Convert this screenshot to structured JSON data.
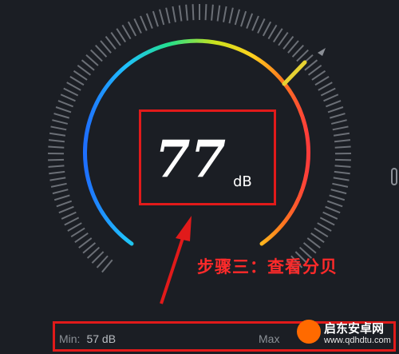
{
  "meter": {
    "value": "77",
    "unit": "dB",
    "arc_colors": [
      "#1e6fff",
      "#1fc0ff",
      "#24e08a",
      "#c9e21e",
      "#ffd11e",
      "#ff7a1e",
      "#ff3b3b"
    ],
    "needle_color": "#e6d233",
    "tick_color": "#6b6f76"
  },
  "annotation": {
    "step_text": "步骤三：查看分贝",
    "highlight_color": "#e11a1a"
  },
  "stats": {
    "min_label": "Min:",
    "min_value": "57 dB",
    "max_label": "Max"
  },
  "watermark": {
    "title": "启东安卓网",
    "url": "www.qdhdtu.com"
  }
}
